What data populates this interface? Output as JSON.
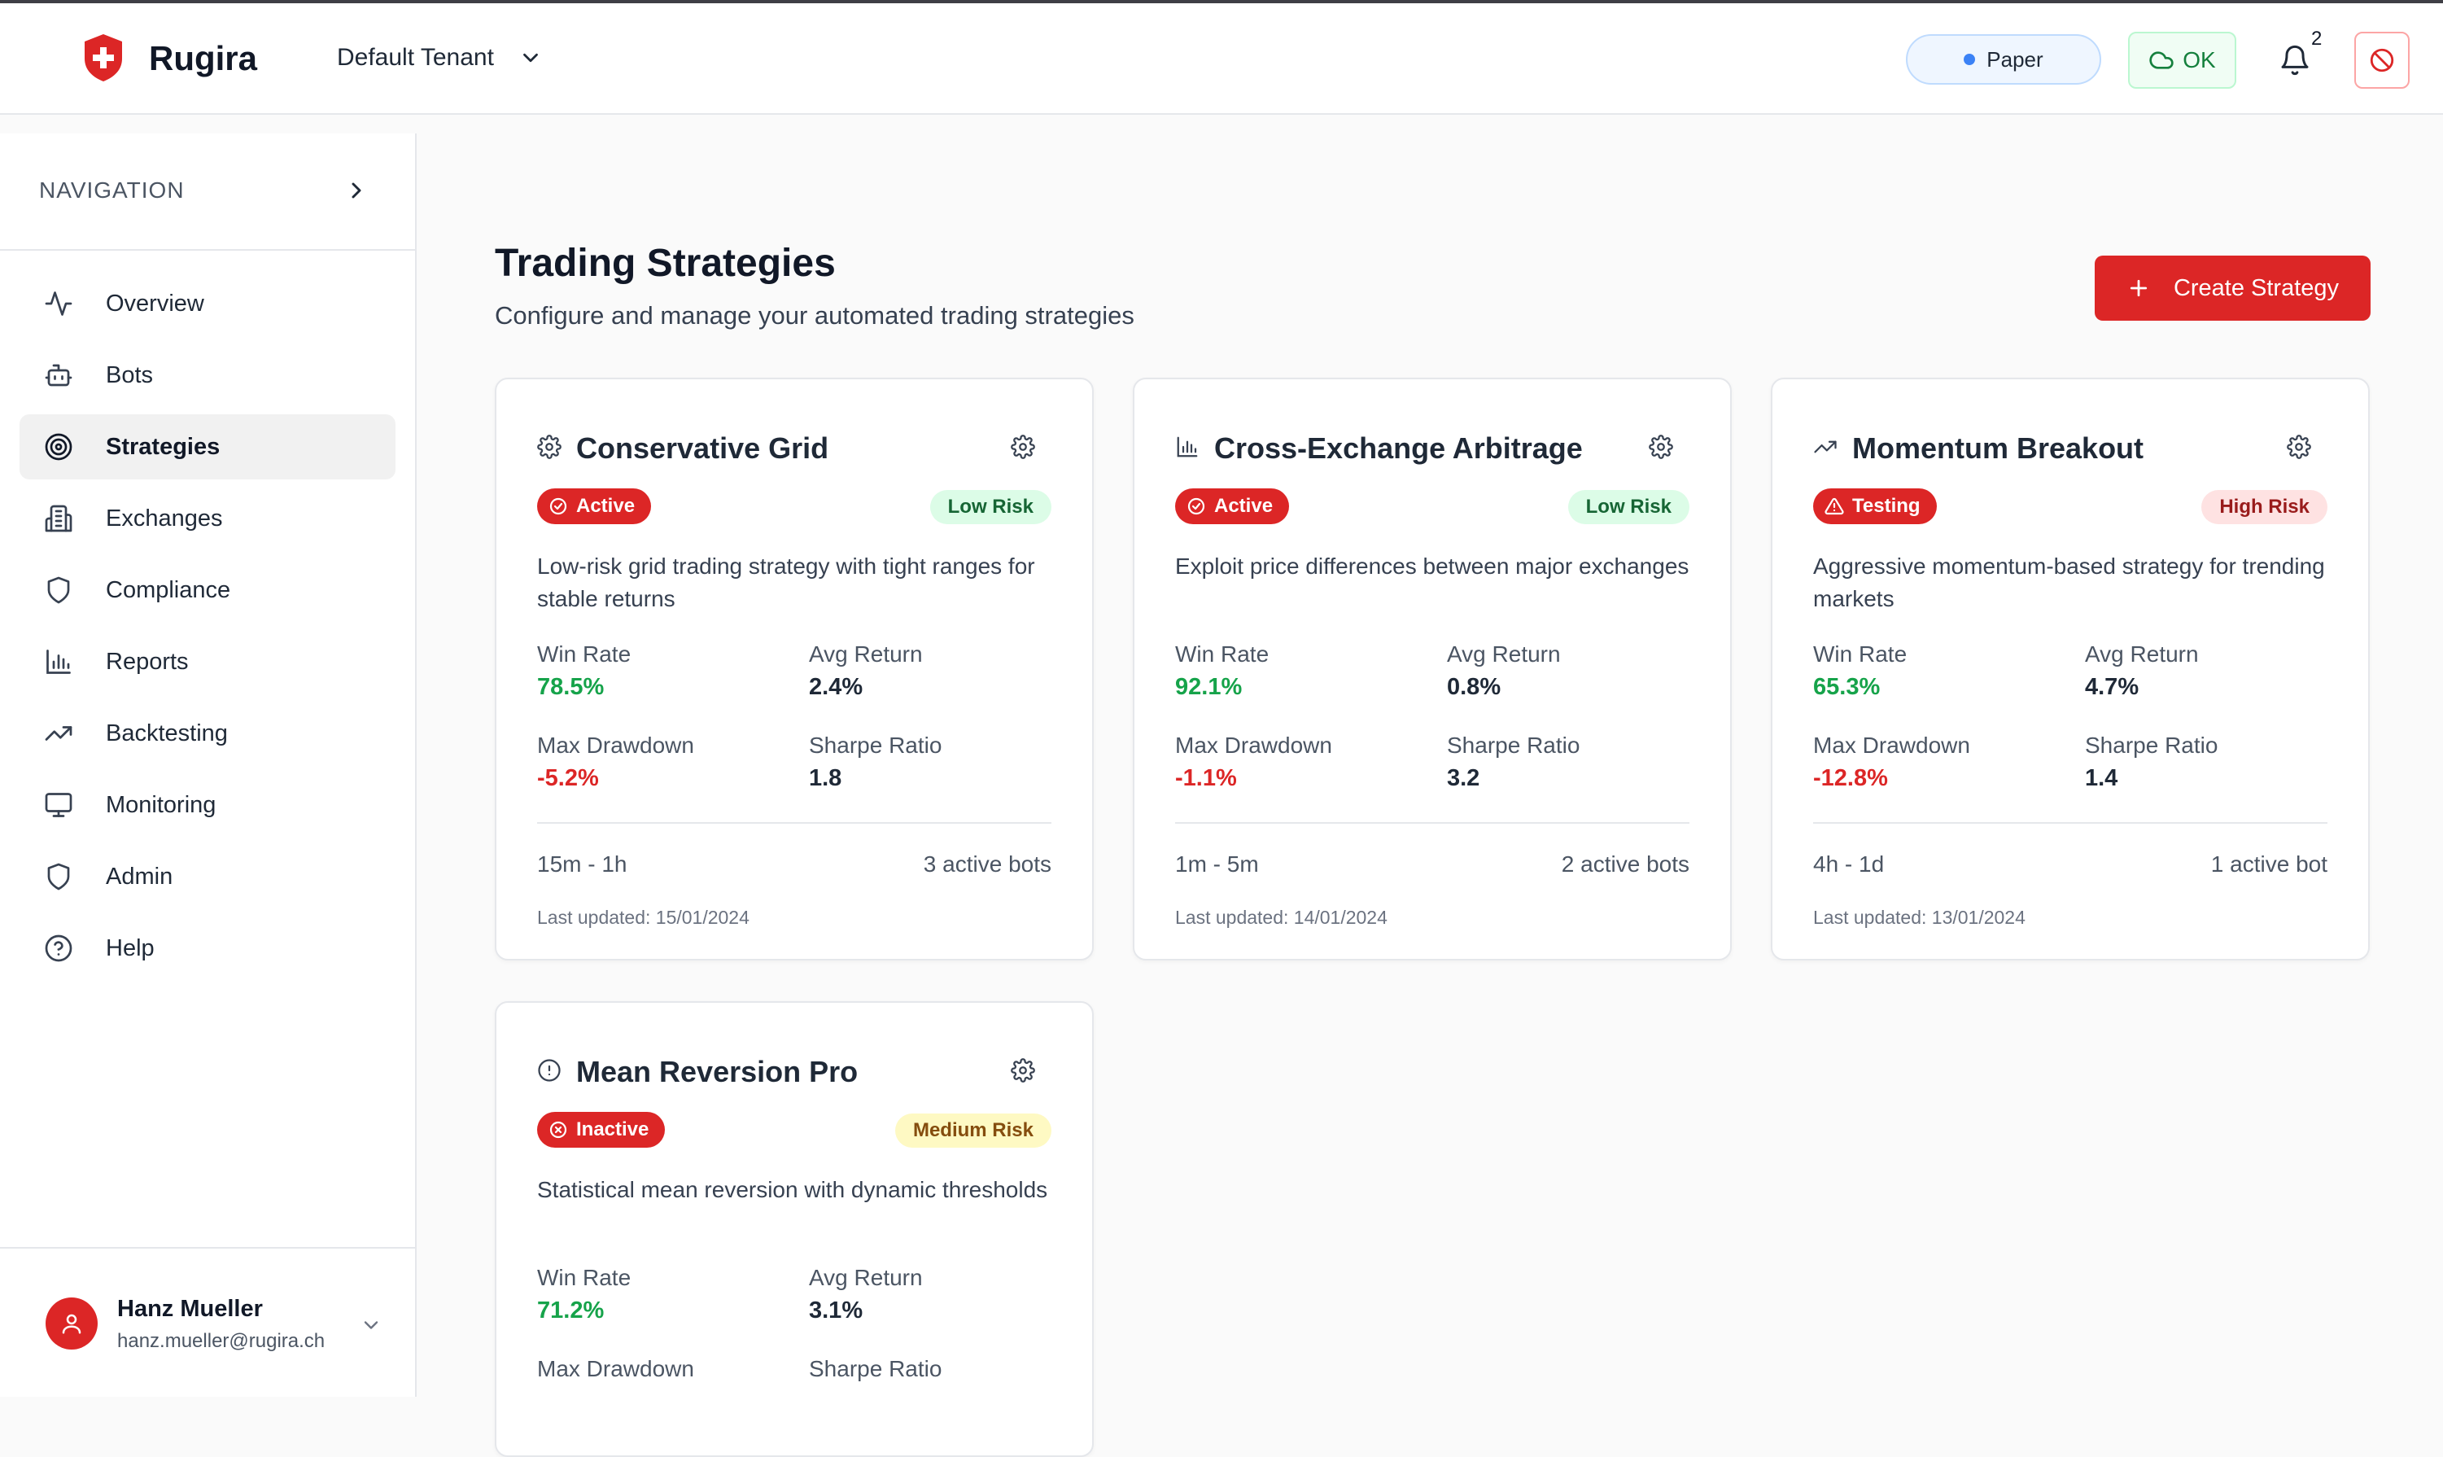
{
  "app": {
    "brand": "Rugira"
  },
  "header": {
    "tenant": "Default Tenant",
    "mode": "Paper",
    "status": "OK",
    "notification_count": "2",
    "colors": {
      "accent": "#dc2626",
      "mode_dot": "#3b82f6",
      "status_green": "#15803d"
    }
  },
  "sidebar": {
    "title": "NAVIGATION",
    "items": [
      {
        "label": "Overview",
        "icon": "activity-icon"
      },
      {
        "label": "Bots",
        "icon": "bot-icon"
      },
      {
        "label": "Strategies",
        "icon": "target-icon",
        "active": true
      },
      {
        "label": "Exchanges",
        "icon": "building-icon"
      },
      {
        "label": "Compliance",
        "icon": "shield-icon"
      },
      {
        "label": "Reports",
        "icon": "bar-chart-icon"
      },
      {
        "label": "Backtesting",
        "icon": "trending-up-icon"
      },
      {
        "label": "Monitoring",
        "icon": "monitor-icon"
      },
      {
        "label": "Admin",
        "icon": "shield-icon"
      },
      {
        "label": "Help",
        "icon": "help-circle-icon"
      }
    ],
    "user": {
      "name": "Hanz Mueller",
      "email": "hanz.mueller@rugira.ch"
    }
  },
  "main": {
    "title": "Trading Strategies",
    "subtitle": "Configure and manage your automated trading strategies",
    "create_label": "Create Strategy",
    "metric_labels": {
      "win_rate": "Win Rate",
      "avg_return": "Avg Return",
      "max_drawdown": "Max Drawdown",
      "sharpe": "Sharpe Ratio"
    },
    "strategies": [
      {
        "icon": "gear-icon",
        "name": "Conservative Grid",
        "status": "Active",
        "risk": "Low Risk",
        "description": "Low-risk grid trading strategy with tight ranges for stable returns",
        "win_rate": "78.5%",
        "avg_return": "2.4%",
        "max_drawdown": "-5.2%",
        "sharpe": "1.8",
        "timeframe": "15m - 1h",
        "bots": "3 active bots",
        "updated": "Last updated: 15/01/2024"
      },
      {
        "icon": "bar-chart-icon",
        "name": "Cross-Exchange Arbitrage",
        "status": "Active",
        "risk": "Low Risk",
        "description": "Exploit price differences between major exchanges",
        "win_rate": "92.1%",
        "avg_return": "0.8%",
        "max_drawdown": "-1.1%",
        "sharpe": "3.2",
        "timeframe": "1m - 5m",
        "bots": "2 active bots",
        "updated": "Last updated: 14/01/2024"
      },
      {
        "icon": "trending-up-icon",
        "name": "Momentum Breakout",
        "status": "Testing",
        "risk": "High Risk",
        "description": "Aggressive momentum-based strategy for trending markets",
        "win_rate": "65.3%",
        "avg_return": "4.7%",
        "max_drawdown": "-12.8%",
        "sharpe": "1.4",
        "timeframe": "4h - 1d",
        "bots": "1 active bot",
        "updated": "Last updated: 13/01/2024"
      },
      {
        "icon": "alert-circle-icon",
        "name": "Mean Reversion Pro",
        "status": "Inactive",
        "risk": "Medium Risk",
        "description": "Statistical mean reversion with dynamic thresholds",
        "win_rate": "71.2%",
        "avg_return": "3.1%"
      }
    ]
  }
}
